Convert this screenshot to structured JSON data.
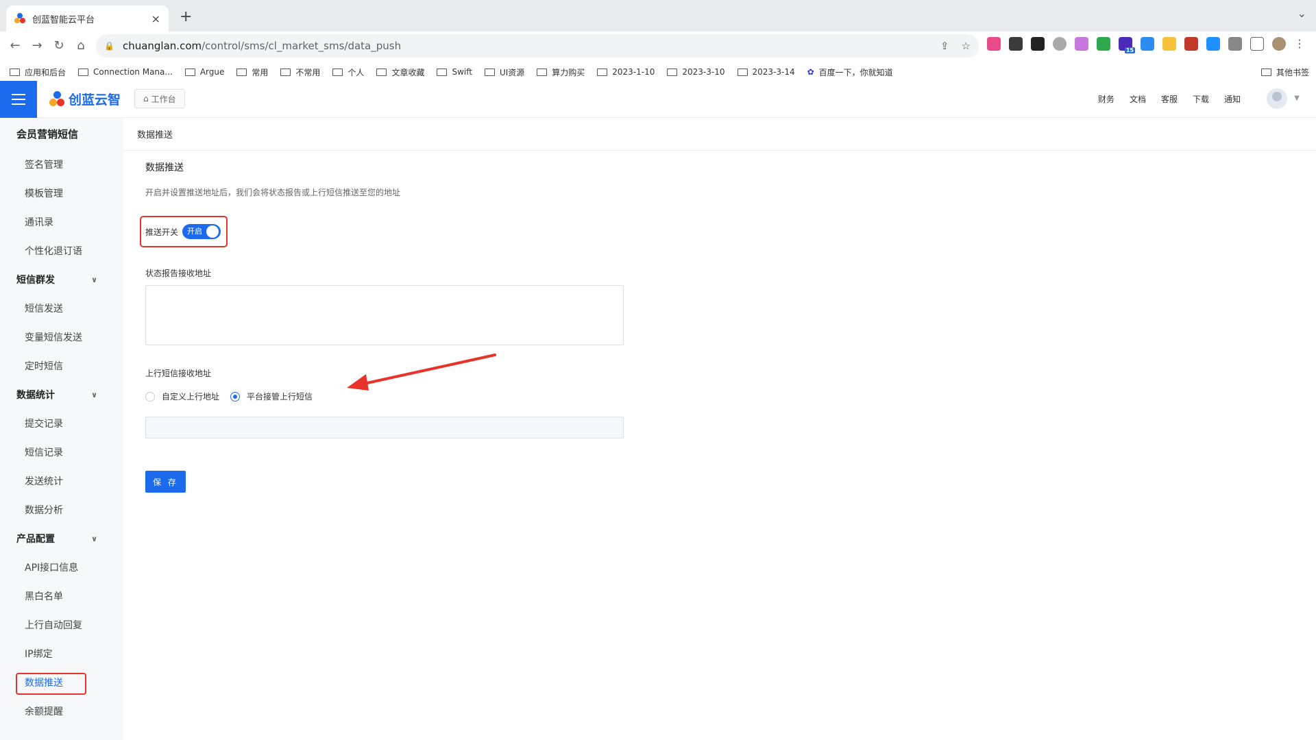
{
  "browser": {
    "tab_title": "创蓝智能云平台",
    "tab_close": "×",
    "new_tab": "+",
    "url_host": "chuanglan.com",
    "url_path": "/control/sms/cl_market_sms/data_push",
    "bookmarks": [
      "应用和后台",
      "Connection Mana...",
      "Argue",
      "常用",
      "不常用",
      "个人",
      "文章收藏",
      "Swift",
      "UI资源",
      "算力购买",
      "2023-1-10",
      "2023-3-10",
      "2023-3-14",
      "百度一下，你就知道"
    ],
    "other_bookmarks": "其他书签",
    "extension_badge": "15"
  },
  "header": {
    "logo_text": "创蓝云智",
    "workbench": "工作台",
    "links": [
      "财务",
      "文档",
      "客服",
      "下载",
      "通知"
    ]
  },
  "sidebar": {
    "title": "会员营销短信",
    "items1": [
      "签名管理",
      "模板管理",
      "通讯录",
      "个性化退订语"
    ],
    "group_sms": "短信群发",
    "items2": [
      "短信发送",
      "变量短信发送",
      "定时短信"
    ],
    "group_stats": "数据统计",
    "items3": [
      "提交记录",
      "短信记录",
      "发送统计",
      "数据分析"
    ],
    "group_config": "产品配置",
    "items4": [
      "API接口信息",
      "黑白名单",
      "上行自动回复",
      "IP绑定"
    ],
    "active_item": "数据推送",
    "last_item": "余额提醒"
  },
  "main": {
    "breadcrumb": "数据推送",
    "section_title": "数据推送",
    "description": "开启并设置推送地址后，我们会将状态报告或上行短信推送至您的地址",
    "switch_label": "推送开关",
    "switch_state": "开启",
    "status_report_label": "状态报告接收地址",
    "status_report_value": "",
    "mo_label": "上行短信接收地址",
    "radio_custom": "自定义上行地址",
    "radio_platform": "平台接管上行短信",
    "mo_value": "",
    "save": "保 存"
  },
  "colors": {
    "primary": "#1c6bef",
    "highlight": "#e8332b"
  }
}
